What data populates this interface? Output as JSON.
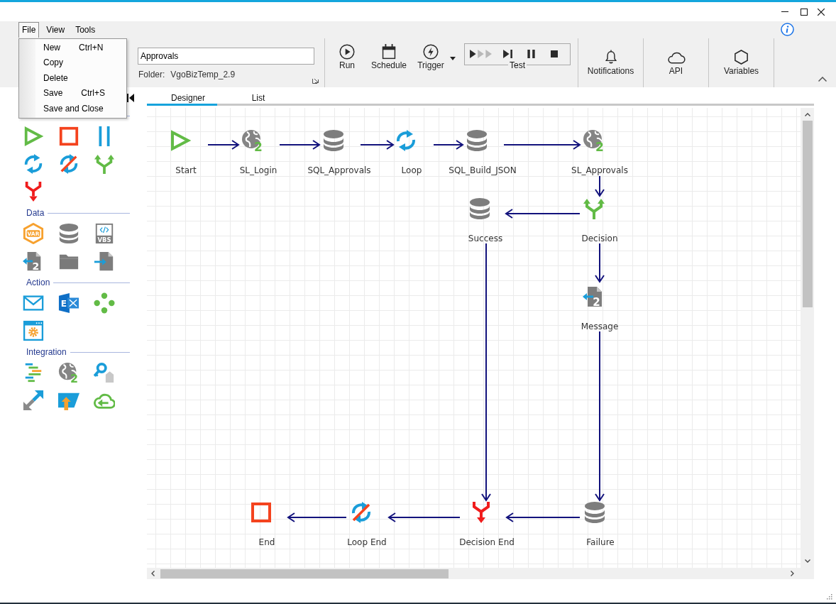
{
  "menu": [
    {
      "label": "File",
      "selected": true
    },
    {
      "label": "View",
      "selected": false
    },
    {
      "label": "Tools",
      "selected": false
    }
  ],
  "file_menu": {
    "items": [
      {
        "label": "New",
        "shortcut": "Ctrl+N"
      },
      {
        "label": "Copy"
      },
      {
        "label": "Delete"
      },
      {
        "label": "Save",
        "shortcut": "Ctrl+S"
      },
      {
        "label": "Save and Close"
      }
    ]
  },
  "process": {
    "name": "Approvals",
    "folder_label": "Folder:",
    "folder": "VgoBizTemp_2.9"
  },
  "toolbar": {
    "buttons": [
      {
        "label": "Run",
        "kind": "run",
        "dropdown": false
      },
      {
        "label": "Schedule",
        "kind": "schedule",
        "dropdown": false
      },
      {
        "label": "Trigger",
        "kind": "trigger",
        "dropdown": true
      }
    ],
    "test_group": {
      "label": "Test",
      "buttons": [
        {
          "kind": "run-all"
        },
        {
          "kind": "step"
        },
        {
          "kind": "pause"
        },
        {
          "kind": "stop"
        }
      ]
    },
    "panels": [
      {
        "label": "Notifications",
        "kind": "notifications"
      },
      {
        "label": "API",
        "kind": "api"
      },
      {
        "label": "Variables",
        "kind": "variables"
      }
    ]
  },
  "palette": {
    "sections": [
      {
        "items": [
          {
            "kind": "start"
          },
          {
            "kind": "end"
          },
          {
            "kind": "pause"
          },
          {
            "kind": "loop"
          },
          {
            "kind": "loop-end"
          },
          {
            "kind": "decision"
          },
          {
            "kind": "decision-end"
          }
        ]
      },
      {
        "title": "Data",
        "items": [
          {
            "kind": "variable",
            "badge": "VAR"
          },
          {
            "kind": "database"
          },
          {
            "kind": "script",
            "badge": "VBS"
          },
          {
            "kind": "message",
            "badge": "2"
          },
          {
            "kind": "folder"
          },
          {
            "kind": "file-import"
          }
        ]
      },
      {
        "title": "Action",
        "items": [
          {
            "kind": "email"
          },
          {
            "kind": "exchange",
            "badge": "E"
          },
          {
            "kind": "workflow"
          },
          {
            "kind": "app-settings"
          }
        ]
      },
      {
        "title": "Integration",
        "items": [
          {
            "kind": "list-lines"
          },
          {
            "kind": "web-service",
            "badge": "2"
          },
          {
            "kind": "key-tag"
          },
          {
            "kind": "arrows-diagonal"
          },
          {
            "kind": "upload"
          },
          {
            "kind": "cloud-arrow"
          }
        ]
      }
    ]
  },
  "tabs": [
    {
      "label": "Designer",
      "selected": true
    },
    {
      "label": "List",
      "selected": false
    }
  ],
  "diagram": {
    "nodes": [
      {
        "label": "Start",
        "kind": "start"
      },
      {
        "label": "SL_Login",
        "kind": "web-service",
        "badge": "2"
      },
      {
        "label": "SQL_Approvals",
        "kind": "database"
      },
      {
        "label": "Loop",
        "kind": "loop"
      },
      {
        "label": "SQL_Build_JSON",
        "kind": "database"
      },
      {
        "label": "SL_Approvals",
        "kind": "web-service",
        "badge": "2"
      },
      {
        "label": "Success",
        "kind": "database"
      },
      {
        "label": "Decision",
        "kind": "decision"
      },
      {
        "label": "Message",
        "kind": "message",
        "badge": "2"
      },
      {
        "label": "End",
        "kind": "end"
      },
      {
        "label": "Loop End",
        "kind": "loop-end"
      },
      {
        "label": "Decision End",
        "kind": "decision-end"
      },
      {
        "label": "Failure",
        "kind": "database"
      }
    ]
  }
}
